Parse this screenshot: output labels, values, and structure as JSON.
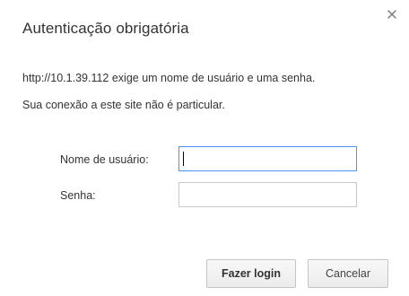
{
  "dialog": {
    "title": "Autenticação obrigatória",
    "message_line1": "http://10.1.39.112 exige um nome de usuário e uma senha.",
    "message_line2": "Sua conexão a este site não é particular.",
    "close_icon": "close-icon"
  },
  "form": {
    "username_label": "Nome de usuário:",
    "username_value": "",
    "password_label": "Senha:",
    "password_value": ""
  },
  "buttons": {
    "login_label": "Fazer login",
    "cancel_label": "Cancelar"
  },
  "colors": {
    "focus_border": "#4d90fe",
    "text": "#333333"
  }
}
